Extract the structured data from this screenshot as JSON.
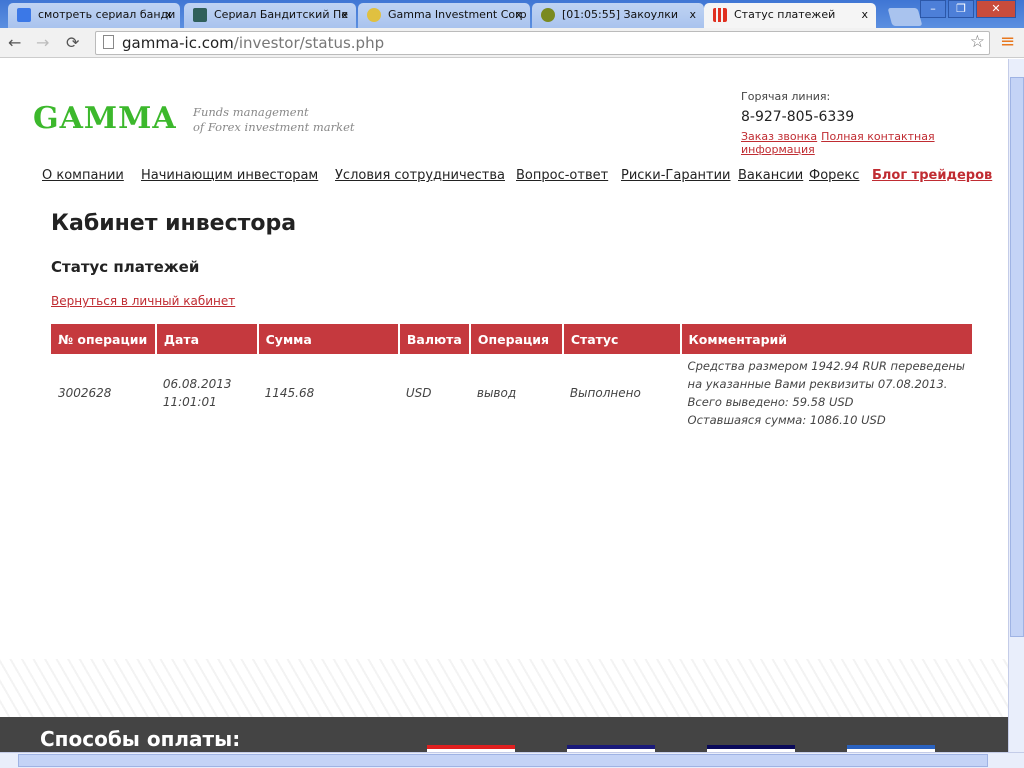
{
  "browser": {
    "tabs": [
      {
        "title": "смотреть сериал банди",
        "icon": "google-icon",
        "color": "#3b78e7"
      },
      {
        "title": "Сериал Бандитский Пе",
        "icon": "site-icon",
        "color": "#2f5f5a"
      },
      {
        "title": "Gamma Investment Corp",
        "icon": "gamma-icon",
        "color": "#e0c040"
      },
      {
        "title": "[01:05:55] Закоулки",
        "icon": "site-icon",
        "color": "#7a8a20"
      },
      {
        "title": "Статус платежей",
        "icon": "signal-icon",
        "color": "#e03020"
      }
    ],
    "close": "x",
    "url_host": "gamma-ic.com",
    "url_path": "/investor/status.php"
  },
  "header": {
    "logo": "GAMMA",
    "tagline1": "Funds management",
    "tagline2": "of Forex investment market",
    "hotline_label": "Горячая линия:",
    "phone": "8-927-805-6339",
    "callback": "Заказ звонка",
    "contacts": "Полная контактная информация"
  },
  "nav": [
    "О компании",
    "Начинающим инвесторам",
    "Условия сотрудничества",
    "Вопрос-ответ",
    "Риски-Гарантии",
    "Вакансии",
    "Форекс",
    "Блог трейдеров"
  ],
  "main": {
    "title": "Кабинет инвестора",
    "subtitle": "Статус платежей",
    "back_link": "Вернуться в личный кабинет",
    "columns": [
      "№ операции",
      "Дата",
      "Сумма",
      "Валюта",
      "Операция",
      "Статус",
      "Комментарий"
    ],
    "rows": [
      {
        "id": "3002628",
        "date": "06.08.2013",
        "time": "11:01:01",
        "amount": "1145.68",
        "currency": "USD",
        "operation": "вывод",
        "status": "Выполнено",
        "comment": [
          "Средства размером 1942.94 RUR переведены",
          "на указанные Вами реквизиты 07.08.2013.",
          "Всего выведено: 59.58 USD",
          "Оставшаяся сумма: 1086.10 USD"
        ]
      }
    ]
  },
  "footer": {
    "title": "Способы оплаты:",
    "payment_colors": [
      "#e02020",
      "#1a1a7a",
      "#0a0a5a",
      "#2a62c0"
    ]
  }
}
